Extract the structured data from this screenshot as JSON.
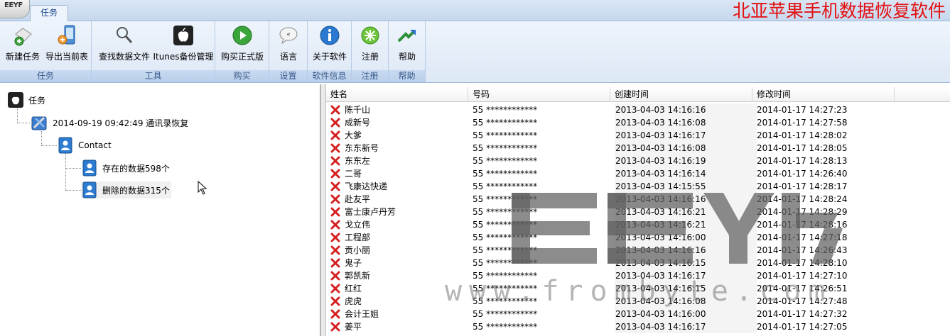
{
  "window": {
    "logo": "EEYF",
    "tab_label": "任务",
    "brand_title": "北亚苹果手机数据恢复软件"
  },
  "ribbon": {
    "groups": [
      {
        "label": "任务",
        "buttons": [
          {
            "label": "新建任务",
            "icon": "new-task-icon"
          },
          {
            "label": "导出当前表",
            "icon": "export-icon"
          }
        ]
      },
      {
        "label": "工具",
        "buttons": [
          {
            "label": "查找数据文件",
            "icon": "magnifier-icon"
          },
          {
            "label": "Itunes备份管理",
            "icon": "apple-icon"
          }
        ]
      },
      {
        "label": "购买",
        "buttons": [
          {
            "label": "购买正式版",
            "icon": "play-icon"
          }
        ]
      },
      {
        "label": "设置",
        "buttons": [
          {
            "label": "语言",
            "icon": "speech-bubble-icon"
          }
        ]
      },
      {
        "label": "软件信息",
        "buttons": [
          {
            "label": "关于软件",
            "icon": "info-icon"
          }
        ]
      },
      {
        "label": "注册",
        "buttons": [
          {
            "label": "注册",
            "icon": "register-icon"
          }
        ]
      },
      {
        "label": "帮助",
        "buttons": [
          {
            "label": "帮助",
            "icon": "help-arrow-icon"
          }
        ]
      }
    ]
  },
  "tree": {
    "root": "任务",
    "task": "2014-09-19 09:42:49 通讯录恢复",
    "contact": "Contact",
    "existing": "存在的数据598个",
    "deleted": "删除的数据315个"
  },
  "table": {
    "columns": [
      "姓名",
      "号码",
      "创建时间",
      "修改时间"
    ],
    "rows": [
      {
        "name": "陈千山",
        "phone": "55 ************",
        "created": "2013-04-03  14:16:16",
        "modified": "2014-01-17  14:27:23"
      },
      {
        "name": "成新号",
        "phone": "55 ************",
        "created": "2013-04-03  14:16:08",
        "modified": "2014-01-17  14:27:58"
      },
      {
        "name": "大爹",
        "phone": "55 ************",
        "created": "2013-04-03  14:16:17",
        "modified": "2014-01-17  14:28:02"
      },
      {
        "name": "东东新号",
        "phone": "55 ************",
        "created": "2013-04-03  14:16:08",
        "modified": "2014-01-17  14:28:05"
      },
      {
        "name": "东东左",
        "phone": "55 ************",
        "created": "2013-04-03  14:16:19",
        "modified": "2014-01-17  14:28:13"
      },
      {
        "name": "二哥",
        "phone": "55 ************",
        "created": "2013-04-03  14:16:14",
        "modified": "2014-01-17  14:26:40"
      },
      {
        "name": "飞康达快递",
        "phone": "55 ************",
        "created": "2013-04-03  14:15:55",
        "modified": "2014-01-17  14:28:17"
      },
      {
        "name": "赴友平",
        "phone": "55 ************",
        "created": "2013-04-03  14:16:16",
        "modified": "2014-01-17  14:28:24"
      },
      {
        "name": "富士康卢丹芳",
        "phone": "55 ************",
        "created": "2013-04-03  14:16:21",
        "modified": "2014-01-17  14:28:29"
      },
      {
        "name": "戈立伟",
        "phone": "55 ************",
        "created": "2013-04-03  14:16:21",
        "modified": "2014-01-17  14:28:16"
      },
      {
        "name": "工程部",
        "phone": "55 ************",
        "created": "2013-04-03  14:16:00",
        "modified": "2014-01-17  14:27:18"
      },
      {
        "name": "贡小丽",
        "phone": "55 ************",
        "created": "2013-04-03  14:16:16",
        "modified": "2014-01-17  14:26:43"
      },
      {
        "name": "鬼子",
        "phone": "55 ************",
        "created": "2013-04-03  14:16:15",
        "modified": "2014-01-17  14:28:10"
      },
      {
        "name": "郭凯新",
        "phone": "55 ************",
        "created": "2013-04-03  14:16:17",
        "modified": "2014-01-17  14:27:10"
      },
      {
        "name": "红红",
        "phone": "55 ************",
        "created": "2013-04-03  14:16:15",
        "modified": "2014-01-17  14:26:51"
      },
      {
        "name": "虎虎",
        "phone": "55 ************",
        "created": "2013-04-03  14:16:08",
        "modified": "2014-01-17  14:27:48"
      },
      {
        "name": "会计王姐",
        "phone": "55 ************",
        "created": "2013-04-03  14:16:00",
        "modified": "2014-01-17  14:27:32"
      },
      {
        "name": "姜平",
        "phone": "55 ************",
        "created": "2013-04-03  14:16:17",
        "modified": "2014-01-17  14:27:05"
      }
    ]
  },
  "watermark": {
    "logo": "EEYF",
    "url": "www.frombyte.com"
  },
  "colors": {
    "brand_red": "#e31010",
    "ribbon_blue": "#dde8f6",
    "delete_red": "#d42020"
  }
}
